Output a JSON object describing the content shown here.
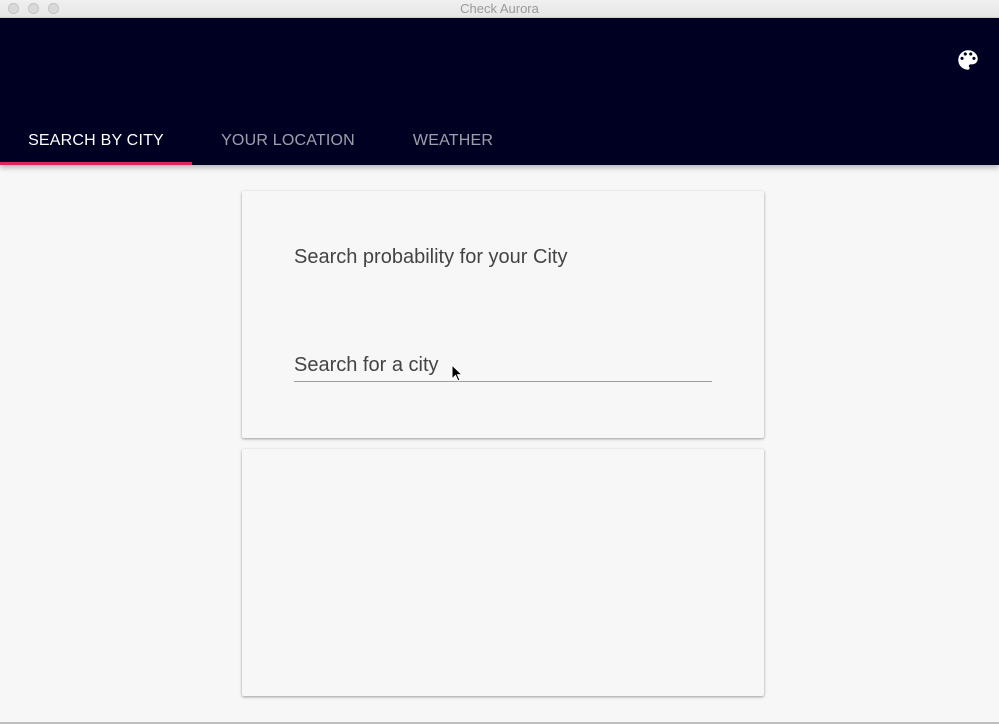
{
  "window": {
    "title": "Check Aurora"
  },
  "header": {
    "palette_icon": "palette-icon",
    "background_color": "#000022",
    "accent_color": "#e2245c"
  },
  "tabs": [
    {
      "label": "SEARCH BY CITY",
      "active": true
    },
    {
      "label": "YOUR LOCATION",
      "active": false
    },
    {
      "label": "WEATHER",
      "active": false
    }
  ],
  "search_card": {
    "heading": "Search probability for your City",
    "input_placeholder": "Search for a city",
    "input_value": ""
  },
  "results_card": {}
}
